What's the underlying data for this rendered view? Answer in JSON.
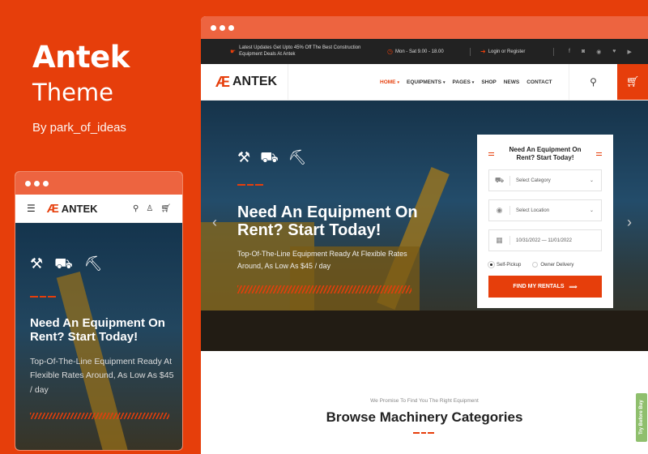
{
  "brand": {
    "name": "Antek",
    "subtitle": "Theme",
    "author": "By park_of_ideas"
  },
  "colors": {
    "accent": "#e63e0b",
    "chrome": "#ed6440",
    "topbar": "#222222",
    "try_badge": "#8fbf6d"
  },
  "desktop": {
    "topbar": {
      "promo": "Latest Updates Get Upto 45% Off The Best Construction Equipment Deals At Antek",
      "hours": "Mon - Sat 9.00 - 18.00",
      "login": "Login or Register",
      "social": [
        "facebook-icon",
        "instagram-icon",
        "whatsapp-icon",
        "twitter-icon",
        "youtube-icon"
      ]
    },
    "logo": "ANTEK",
    "menu": [
      {
        "label": "HOME",
        "dropdown": true,
        "active": true
      },
      {
        "label": "EQUIPMENTS",
        "dropdown": true
      },
      {
        "label": "PAGES",
        "dropdown": true
      },
      {
        "label": "SHOP"
      },
      {
        "label": "NEWS"
      },
      {
        "label": "CONTACT"
      }
    ],
    "hero": {
      "title": "Need An Equipment On Rent? Start Today!",
      "text": "Top-Of-The-Line Equipment Ready At Flexible Rates Around, As Low As $45 / day",
      "icons": [
        "drill-icon",
        "dump-truck-icon",
        "excavator-icon"
      ]
    },
    "form": {
      "title": "Need An Equipment On Rent? Start Today!",
      "category_placeholder": "Select Category",
      "location_placeholder": "Select Location",
      "date_range": "10/31/2022 — 11/01/2022",
      "options": [
        {
          "label": "Self-Pickup",
          "selected": true
        },
        {
          "label": "Owner Delivery",
          "selected": false
        }
      ],
      "submit": "FIND MY RENTALS"
    },
    "section": {
      "subtitle": "We Promise To Find You The Right Equipment",
      "title": "Browse Machinery Categories"
    },
    "try_badge": "Try Before Buy"
  },
  "mobile": {
    "logo": "ANTEK",
    "hero": {
      "title": "Need An Equipment On Rent? Start Today!",
      "text": "Top-Of-The-Line Equipment Ready At Flexible Rates Around, As Low As $45 / day"
    }
  }
}
